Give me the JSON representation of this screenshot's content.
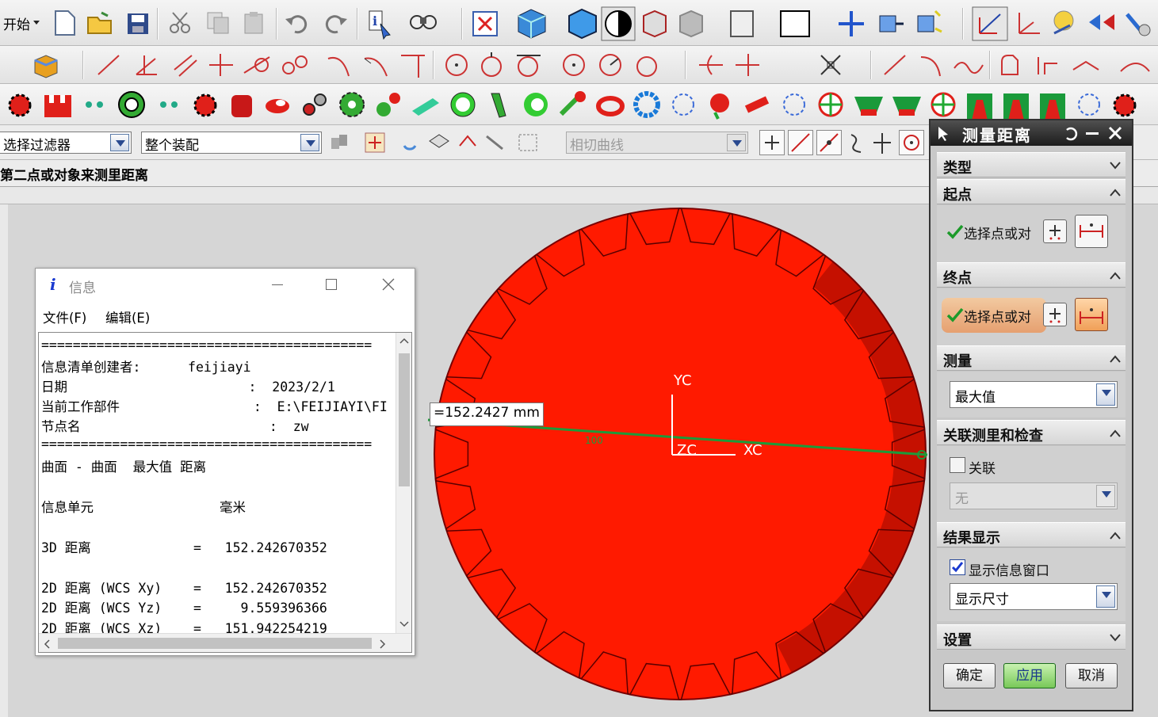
{
  "toolbar": {
    "start_label": "开始",
    "filter_select": "选择过滤器",
    "scope_select": "整个装配",
    "curve_rule_select": "相切曲线"
  },
  "cue_line": "第二点或对象来测里距离",
  "info_window": {
    "title": "信息",
    "menu": [
      "文件(F)",
      "编辑(E)"
    ],
    "lines": [
      "==========================================",
      "信息清单创建者:      feijiayi",
      "日期                       :  2023/2/1",
      "当前工作部件                 :  E:\\FEIJIAYI\\FI",
      "节点名                        :  zw",
      "==========================================",
      "曲面 - 曲面  最大值 距离",
      "",
      "信息单元                毫米",
      "",
      "3D 距离             =   152.242670352",
      "",
      "2D 距离 (WCS Xy)    =   152.242670352",
      "2D 距离 (WCS Yz)    =     9.559396366",
      "2D 距离 (WCS Xz)    =   151.942254219"
    ]
  },
  "viewport": {
    "measure_label": "=152.2427 mm",
    "dim_small": "100",
    "axis_yc": "YC",
    "axis_xc": "XC",
    "axis_zc": "ZC",
    "gear_color": "#ff1a00",
    "measure_line_color": "#1e9a3a"
  },
  "measure_dialog": {
    "title": "测量距离",
    "sections": {
      "type": "类型",
      "start": "起点",
      "end": "终点",
      "measure": "测量",
      "assoc": "关联测里和检查",
      "result": "结果显示",
      "settings": "设置"
    },
    "start_select_label": "选择点或对",
    "end_select_label": "选择点或对",
    "measure_mode": "最大值",
    "assoc_checkbox": "关联",
    "assoc_value": "无",
    "show_info_checkbox": "显示信息窗口",
    "show_info_checked": true,
    "display_mode": "显示尺寸",
    "ok": "确定",
    "apply": "应用",
    "cancel": "取消"
  }
}
